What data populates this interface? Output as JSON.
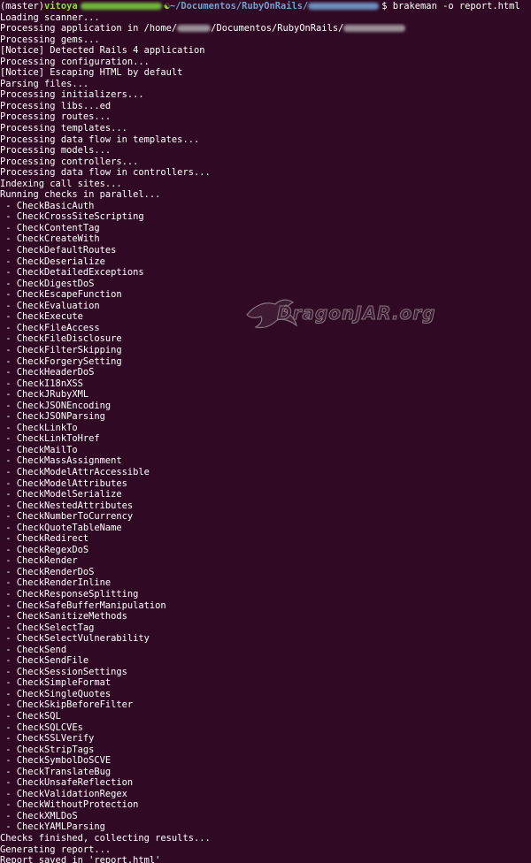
{
  "prompt": {
    "branch": "(master)",
    "user": "vitoya",
    "separator": "~/Documentos/RubyOnRails/",
    "command": "$ brakeman -o report.html"
  },
  "output_lines": [
    "Loading scanner...",
    "Processing application in /home/",
    "/Documentos/RubyOnRails/",
    "Processing gems...",
    "[Notice] Detected Rails 4 application",
    "Processing configuration...",
    "[Notice] Escaping HTML by default",
    "Parsing files...",
    "Processing initializers...",
    "Processing libs...ed",
    "Processing routes...",
    "Processing templates...",
    "Processing data flow in templates...",
    "Processing models...",
    "Processing controllers...",
    "Processing data flow in controllers...",
    "Indexing call sites...",
    "Running checks in parallel..."
  ],
  "checks": [
    " - CheckBasicAuth",
    " - CheckCrossSiteScripting",
    " - CheckContentTag",
    " - CheckCreateWith",
    " - CheckDefaultRoutes",
    " - CheckDeserialize",
    " - CheckDetailedExceptions",
    " - CheckDigestDoS",
    " - CheckEscapeFunction",
    " - CheckEvaluation",
    " - CheckExecute",
    " - CheckFileAccess",
    " - CheckFileDisclosure",
    " - CheckFilterSkipping",
    " - CheckForgerySetting",
    " - CheckHeaderDoS",
    " - CheckI18nXSS",
    " - CheckJRubyXML",
    " - CheckJSONEncoding",
    " - CheckJSONParsing",
    " - CheckLinkTo",
    " - CheckLinkToHref",
    " - CheckMailTo",
    " - CheckMassAssignment",
    " - CheckModelAttrAccessible",
    " - CheckModelAttributes",
    " - CheckModelSerialize",
    " - CheckNestedAttributes",
    " - CheckNumberToCurrency",
    " - CheckQuoteTableName",
    " - CheckRedirect",
    " - CheckRegexDoS",
    " - CheckRender",
    " - CheckRenderDoS",
    " - CheckRenderInline",
    " - CheckResponseSplitting",
    " - CheckSafeBufferManipulation",
    " - CheckSanitizeMethods",
    " - CheckSelectTag",
    " - CheckSelectVulnerability",
    " - CheckSend",
    " - CheckSendFile",
    " - CheckSessionSettings",
    " - CheckSimpleFormat",
    " - CheckSingleQuotes",
    " - CheckSkipBeforeFilter",
    " - CheckSQL",
    " - CheckSQLCVEs",
    " - CheckSSLVerify",
    " - CheckStripTags",
    " - CheckSymbolDoSCVE",
    " - CheckTranslateBug",
    " - CheckUnsafeReflection",
    " - CheckValidationRegex",
    " - CheckWithoutProtection",
    " - CheckXMLDoS",
    " - CheckYAMLParsing"
  ],
  "footer_lines": [
    "Checks finished, collecting results...",
    "Generating report...",
    "Report saved in 'report.html'"
  ],
  "watermark": {
    "text": "DragonJAR.org",
    "icon": "dragon-icon"
  },
  "colors": {
    "background": "#300a24",
    "foreground": "#ffffff",
    "prompt_user": "#8ae234",
    "prompt_path": "#729fcf"
  }
}
